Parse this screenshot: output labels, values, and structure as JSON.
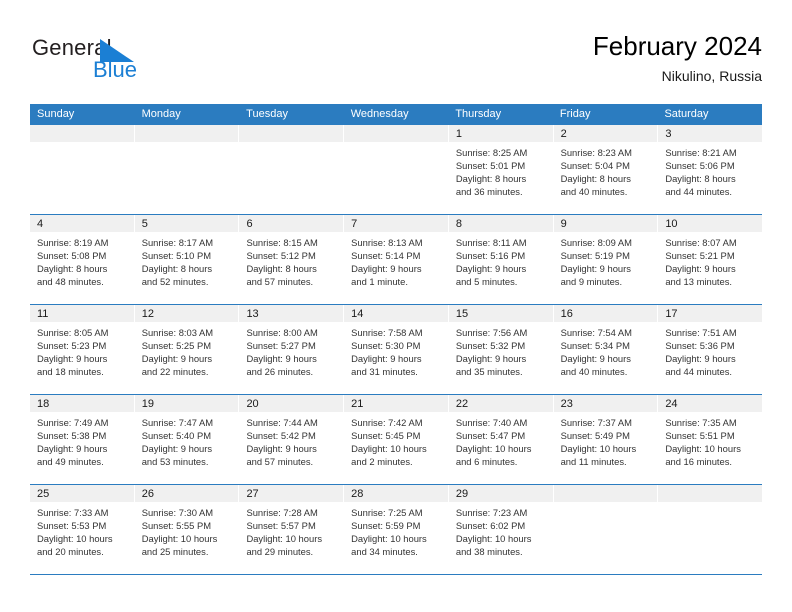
{
  "brand": {
    "name_part1": "General",
    "name_part2": "Blue",
    "triangle_icon": "blue-triangle-icon",
    "accent_color": "#1b7fd4"
  },
  "header": {
    "title": "February 2024",
    "location": "Nikulino, Russia"
  },
  "theme": {
    "header_blue": "#2b7cc0",
    "day_band_gray": "#f0f0f0",
    "text_color": "#333333"
  },
  "calendar": {
    "weekday_headers": [
      "Sunday",
      "Monday",
      "Tuesday",
      "Wednesday",
      "Thursday",
      "Friday",
      "Saturday"
    ],
    "weeks": [
      [
        {
          "day": "",
          "lines": []
        },
        {
          "day": "",
          "lines": []
        },
        {
          "day": "",
          "lines": []
        },
        {
          "day": "",
          "lines": []
        },
        {
          "day": "1",
          "lines": [
            "Sunrise: 8:25 AM",
            "Sunset: 5:01 PM",
            "Daylight: 8 hours",
            "and 36 minutes."
          ]
        },
        {
          "day": "2",
          "lines": [
            "Sunrise: 8:23 AM",
            "Sunset: 5:04 PM",
            "Daylight: 8 hours",
            "and 40 minutes."
          ]
        },
        {
          "day": "3",
          "lines": [
            "Sunrise: 8:21 AM",
            "Sunset: 5:06 PM",
            "Daylight: 8 hours",
            "and 44 minutes."
          ]
        }
      ],
      [
        {
          "day": "4",
          "lines": [
            "Sunrise: 8:19 AM",
            "Sunset: 5:08 PM",
            "Daylight: 8 hours",
            "and 48 minutes."
          ]
        },
        {
          "day": "5",
          "lines": [
            "Sunrise: 8:17 AM",
            "Sunset: 5:10 PM",
            "Daylight: 8 hours",
            "and 52 minutes."
          ]
        },
        {
          "day": "6",
          "lines": [
            "Sunrise: 8:15 AM",
            "Sunset: 5:12 PM",
            "Daylight: 8 hours",
            "and 57 minutes."
          ]
        },
        {
          "day": "7",
          "lines": [
            "Sunrise: 8:13 AM",
            "Sunset: 5:14 PM",
            "Daylight: 9 hours",
            "and 1 minute."
          ]
        },
        {
          "day": "8",
          "lines": [
            "Sunrise: 8:11 AM",
            "Sunset: 5:16 PM",
            "Daylight: 9 hours",
            "and 5 minutes."
          ]
        },
        {
          "day": "9",
          "lines": [
            "Sunrise: 8:09 AM",
            "Sunset: 5:19 PM",
            "Daylight: 9 hours",
            "and 9 minutes."
          ]
        },
        {
          "day": "10",
          "lines": [
            "Sunrise: 8:07 AM",
            "Sunset: 5:21 PM",
            "Daylight: 9 hours",
            "and 13 minutes."
          ]
        }
      ],
      [
        {
          "day": "11",
          "lines": [
            "Sunrise: 8:05 AM",
            "Sunset: 5:23 PM",
            "Daylight: 9 hours",
            "and 18 minutes."
          ]
        },
        {
          "day": "12",
          "lines": [
            "Sunrise: 8:03 AM",
            "Sunset: 5:25 PM",
            "Daylight: 9 hours",
            "and 22 minutes."
          ]
        },
        {
          "day": "13",
          "lines": [
            "Sunrise: 8:00 AM",
            "Sunset: 5:27 PM",
            "Daylight: 9 hours",
            "and 26 minutes."
          ]
        },
        {
          "day": "14",
          "lines": [
            "Sunrise: 7:58 AM",
            "Sunset: 5:30 PM",
            "Daylight: 9 hours",
            "and 31 minutes."
          ]
        },
        {
          "day": "15",
          "lines": [
            "Sunrise: 7:56 AM",
            "Sunset: 5:32 PM",
            "Daylight: 9 hours",
            "and 35 minutes."
          ]
        },
        {
          "day": "16",
          "lines": [
            "Sunrise: 7:54 AM",
            "Sunset: 5:34 PM",
            "Daylight: 9 hours",
            "and 40 minutes."
          ]
        },
        {
          "day": "17",
          "lines": [
            "Sunrise: 7:51 AM",
            "Sunset: 5:36 PM",
            "Daylight: 9 hours",
            "and 44 minutes."
          ]
        }
      ],
      [
        {
          "day": "18",
          "lines": [
            "Sunrise: 7:49 AM",
            "Sunset: 5:38 PM",
            "Daylight: 9 hours",
            "and 49 minutes."
          ]
        },
        {
          "day": "19",
          "lines": [
            "Sunrise: 7:47 AM",
            "Sunset: 5:40 PM",
            "Daylight: 9 hours",
            "and 53 minutes."
          ]
        },
        {
          "day": "20",
          "lines": [
            "Sunrise: 7:44 AM",
            "Sunset: 5:42 PM",
            "Daylight: 9 hours",
            "and 57 minutes."
          ]
        },
        {
          "day": "21",
          "lines": [
            "Sunrise: 7:42 AM",
            "Sunset: 5:45 PM",
            "Daylight: 10 hours",
            "and 2 minutes."
          ]
        },
        {
          "day": "22",
          "lines": [
            "Sunrise: 7:40 AM",
            "Sunset: 5:47 PM",
            "Daylight: 10 hours",
            "and 6 minutes."
          ]
        },
        {
          "day": "23",
          "lines": [
            "Sunrise: 7:37 AM",
            "Sunset: 5:49 PM",
            "Daylight: 10 hours",
            "and 11 minutes."
          ]
        },
        {
          "day": "24",
          "lines": [
            "Sunrise: 7:35 AM",
            "Sunset: 5:51 PM",
            "Daylight: 10 hours",
            "and 16 minutes."
          ]
        }
      ],
      [
        {
          "day": "25",
          "lines": [
            "Sunrise: 7:33 AM",
            "Sunset: 5:53 PM",
            "Daylight: 10 hours",
            "and 20 minutes."
          ]
        },
        {
          "day": "26",
          "lines": [
            "Sunrise: 7:30 AM",
            "Sunset: 5:55 PM",
            "Daylight: 10 hours",
            "and 25 minutes."
          ]
        },
        {
          "day": "27",
          "lines": [
            "Sunrise: 7:28 AM",
            "Sunset: 5:57 PM",
            "Daylight: 10 hours",
            "and 29 minutes."
          ]
        },
        {
          "day": "28",
          "lines": [
            "Sunrise: 7:25 AM",
            "Sunset: 5:59 PM",
            "Daylight: 10 hours",
            "and 34 minutes."
          ]
        },
        {
          "day": "29",
          "lines": [
            "Sunrise: 7:23 AM",
            "Sunset: 6:02 PM",
            "Daylight: 10 hours",
            "and 38 minutes."
          ]
        },
        {
          "day": "",
          "lines": []
        },
        {
          "day": "",
          "lines": []
        }
      ]
    ]
  }
}
